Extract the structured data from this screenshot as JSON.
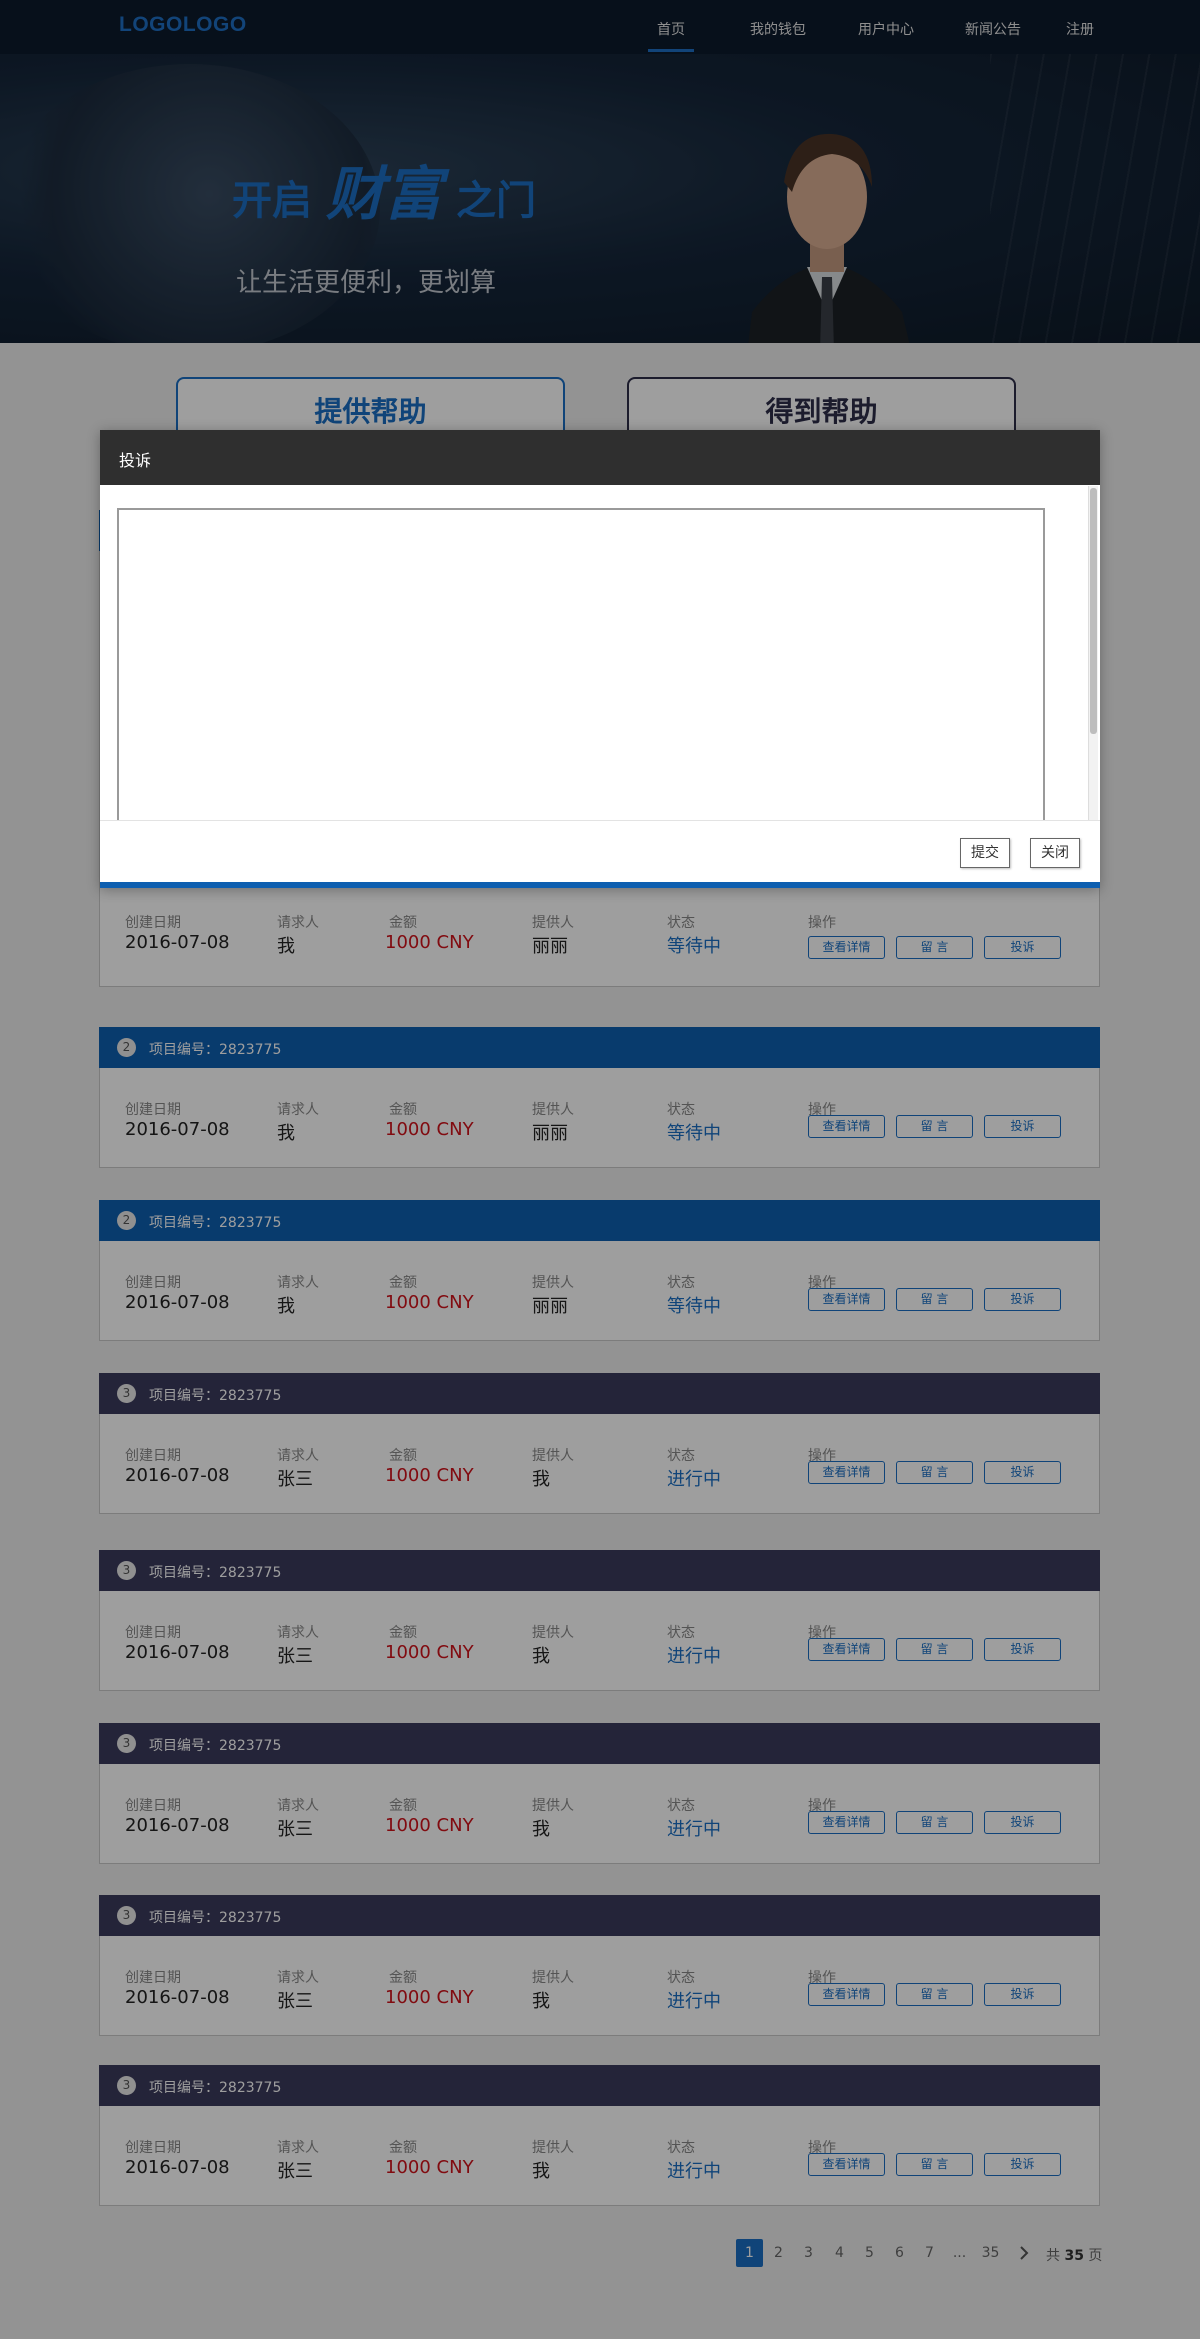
{
  "header": {
    "logo": "LOGOLOGO",
    "nav": [
      "首页",
      "我的钱包",
      "用户中心",
      "新闻公告",
      "注册"
    ],
    "active_nav": "首页"
  },
  "hero": {
    "title_part1": "开启",
    "title_part2": "财富",
    "title_part3": "之门",
    "subtitle": "让生活更便利，更划算"
  },
  "help_buttons": {
    "provide": "提供帮助",
    "get": "得到帮助"
  },
  "columns": {
    "date": "创建日期",
    "requester": "请求人",
    "amount": "金额",
    "provider": "提供人",
    "status": "状态",
    "action": "操作"
  },
  "actions": {
    "details": "查看详情",
    "message": "留 言",
    "complaint": "投诉"
  },
  "cards": [
    {
      "num": "",
      "project": "",
      "date": "2016-07-08",
      "requester": "我",
      "amount": "1000 CNY",
      "provider": "丽丽",
      "status": "等待中"
    },
    {
      "num": "2",
      "project": "项目编号：2823775",
      "date": "2016-07-08",
      "requester": "我",
      "amount": "1000 CNY",
      "provider": "丽丽",
      "status": "等待中"
    },
    {
      "num": "2",
      "project": "项目编号：2823775",
      "date": "2016-07-08",
      "requester": "我",
      "amount": "1000 CNY",
      "provider": "丽丽",
      "status": "等待中"
    },
    {
      "num": "3",
      "project": "项目编号：2823775",
      "date": "2016-07-08",
      "requester": "张三",
      "amount": "1000 CNY",
      "provider": "我",
      "status": "进行中"
    },
    {
      "num": "3",
      "project": "项目编号：2823775",
      "date": "2016-07-08",
      "requester": "张三",
      "amount": "1000 CNY",
      "provider": "我",
      "status": "进行中"
    },
    {
      "num": "3",
      "project": "项目编号：2823775",
      "date": "2016-07-08",
      "requester": "张三",
      "amount": "1000 CNY",
      "provider": "我",
      "status": "进行中"
    },
    {
      "num": "3",
      "project": "项目编号：2823775",
      "date": "2016-07-08",
      "requester": "张三",
      "amount": "1000 CNY",
      "provider": "我",
      "status": "进行中"
    },
    {
      "num": "3",
      "project": "项目编号：2823775",
      "date": "2016-07-08",
      "requester": "张三",
      "amount": "1000 CNY",
      "provider": "我",
      "status": "进行中"
    }
  ],
  "pagination": {
    "pages": [
      "1",
      "2",
      "3",
      "4",
      "5",
      "6",
      "7",
      "...",
      "35"
    ],
    "current": "1",
    "total_prefix": "共",
    "total": "35",
    "total_suffix": "页",
    "next_icon": "chevron-right-icon"
  },
  "modal": {
    "title": "投诉",
    "textarea_value": "",
    "submit": "提交",
    "close": "关闭"
  },
  "colors": {
    "brand_blue": "#1a6fc4",
    "card_blue": "#0e5fb0",
    "card_dark": "#3b3a5c",
    "amount_red": "#d0121b"
  }
}
